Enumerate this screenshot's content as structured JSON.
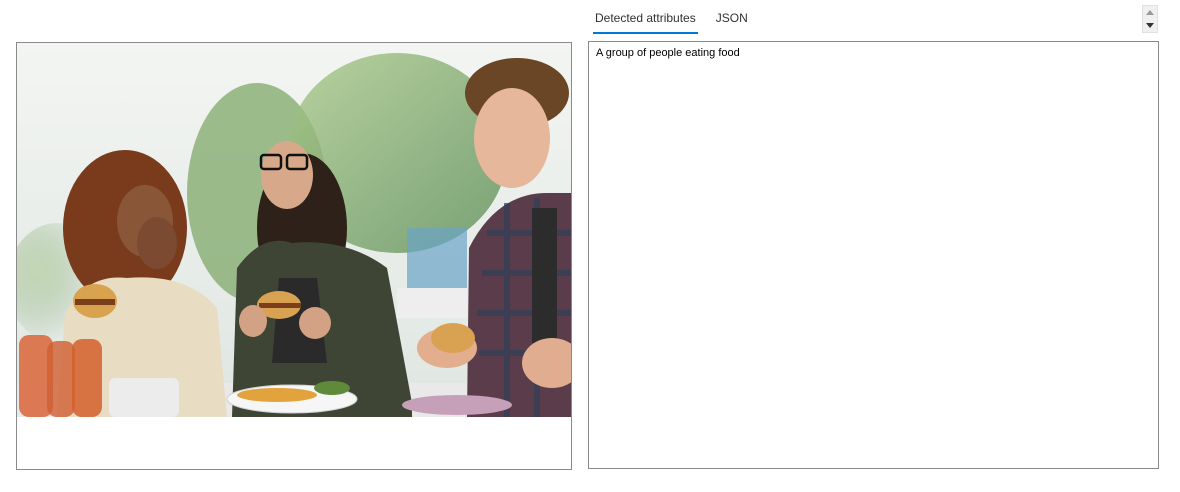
{
  "tabs": [
    {
      "label": "Detected attributes",
      "active": true
    },
    {
      "label": "JSON",
      "active": false
    }
  ],
  "output": {
    "caption": "A group of people eating food"
  },
  "image": {
    "alt": "A group of people eating food"
  },
  "colors": {
    "accent": "#0078d4",
    "border": "#8a8a8a"
  },
  "icons": {
    "scroll_up": "triangle-up-icon",
    "scroll_down": "triangle-down-icon"
  }
}
